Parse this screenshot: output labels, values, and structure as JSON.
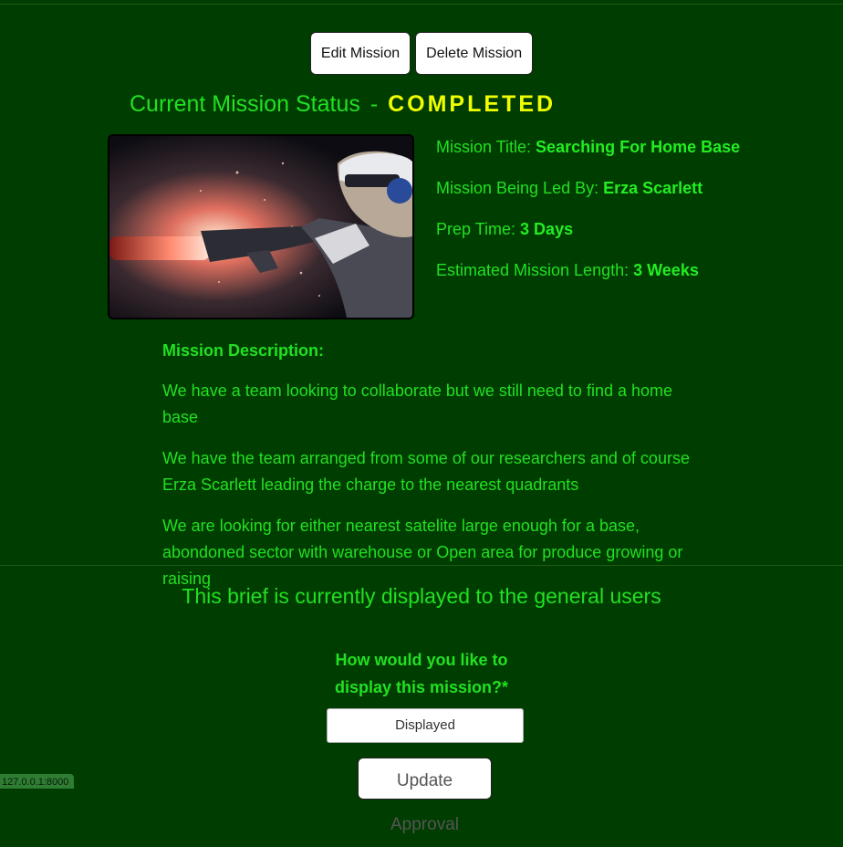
{
  "toolbar": {
    "edit_label": "Edit Mission",
    "delete_label": "Delete Mission"
  },
  "status": {
    "prefix": "Current Mission Status",
    "separator": "-",
    "value": "COMPLETED"
  },
  "mission": {
    "title_label": "Mission Title:",
    "title_value": "Searching For Home Base",
    "leader_label": "Mission Being Led By:",
    "leader_value": "Erza Scarlett",
    "prep_label": "Prep Time:",
    "prep_value": "3 Days",
    "length_label": "Estimated Mission Length:",
    "length_value": "3 Weeks",
    "image_icon": "soldier-with-rifle-image"
  },
  "description": {
    "label": "Mission Description:",
    "paragraphs": [
      "We have a team looking to collaborate but we still need to find a home base",
      "We have the team arranged from some of our researchers and of course Erza Scarlett leading the charge to the nearest quadrants",
      "We are looking for either nearest satelite large enough for a base, abondoned sector with warehouse or Open area for produce growing or raising"
    ]
  },
  "approval": {
    "brief_text": "This brief is currently displayed to the general users",
    "question_line1": "How would you like to",
    "question_line2": "display this mission?*",
    "select_value": "Displayed",
    "update_label": "Update Approval"
  },
  "footer": {
    "host": "127.0.0.1:8000"
  },
  "colors": {
    "background": "#003d00",
    "text": "#22e022",
    "status_accent": "#f0ff00"
  }
}
